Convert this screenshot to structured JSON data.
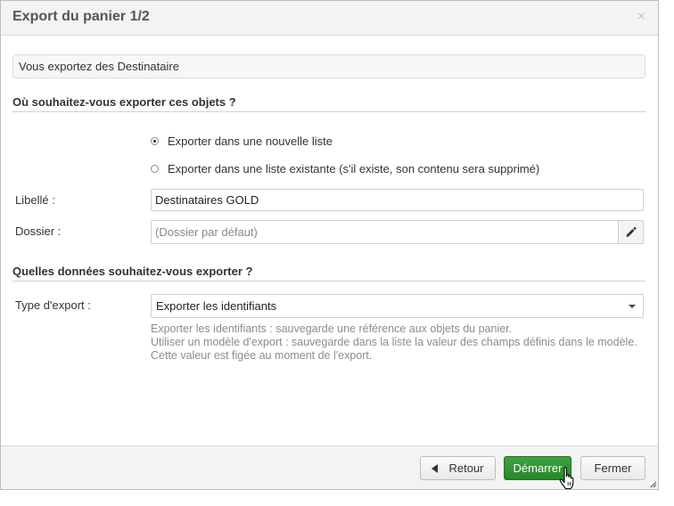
{
  "dialog": {
    "title": "Export du panier 1/2",
    "close_glyph": "×",
    "info_text": "Vous exportez des Destinataire"
  },
  "section1": {
    "title": "Où souhaitez-vous exporter ces objets ?",
    "options": [
      {
        "label": "Exporter dans une nouvelle liste",
        "checked": true
      },
      {
        "label": "Exporter dans une liste existante (s'il existe, son contenu sera supprimé)",
        "checked": false
      }
    ],
    "libelle_label": "Libellé :",
    "libelle_value": "Destinataires GOLD",
    "dossier_label": "Dossier :",
    "dossier_placeholder": "(Dossier par défaut)",
    "edit_icon": "pencil-icon"
  },
  "section2": {
    "title": "Quelles données souhaitez-vous exporter ?",
    "type_label": "Type d'export :",
    "type_value": "Exporter les identifiants",
    "help": [
      "Exporter les identifiants : sauvegarde une référence aux objets du panier.",
      "Utiliser un modèle d'export : sauvegarde dans la liste la valeur des champs définis dans le modèle. Cette valeur est figée au moment de l'export."
    ]
  },
  "footer": {
    "back_label": "Retour",
    "start_label": "Démarrer",
    "close_label": "Fermer"
  },
  "colors": {
    "primary_button": "#2e8b2e",
    "header_bg": "#f3f3f3",
    "help_text": "#8c8c8c"
  }
}
